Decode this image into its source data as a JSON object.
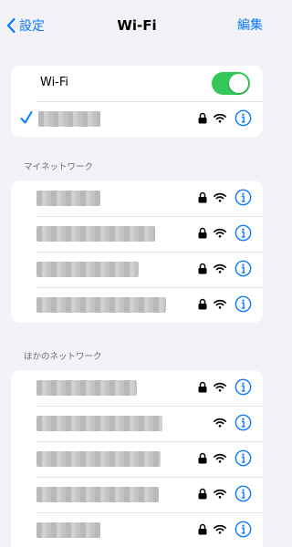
{
  "nav": {
    "back_label": "設定",
    "title": "Wi-Fi",
    "edit_label": "編集"
  },
  "wifi_toggle": {
    "label": "Wi-Fi",
    "on": true
  },
  "current_network": {
    "name": "",
    "secured": true,
    "connected": true
  },
  "sections": {
    "my_networks": {
      "title": "マイネットワーク",
      "networks": [
        {
          "name": "",
          "secured": true
        },
        {
          "name": "",
          "secured": true
        },
        {
          "name": "",
          "secured": true
        },
        {
          "name": "",
          "secured": true
        }
      ]
    },
    "other_networks": {
      "title": "ほかのネットワーク",
      "networks": [
        {
          "name": "",
          "secured": true
        },
        {
          "name": "",
          "secured": false
        },
        {
          "name": "",
          "secured": true
        },
        {
          "name": "",
          "secured": true
        },
        {
          "name": "",
          "secured": true
        }
      ]
    }
  },
  "colors": {
    "accent": "#0a7aff",
    "toggle_on": "#34c759",
    "background": "#f2f2f7"
  },
  "icons": [
    "chevron-left-icon",
    "checkmark-icon",
    "lock-icon",
    "wifi-icon",
    "info-icon"
  ]
}
